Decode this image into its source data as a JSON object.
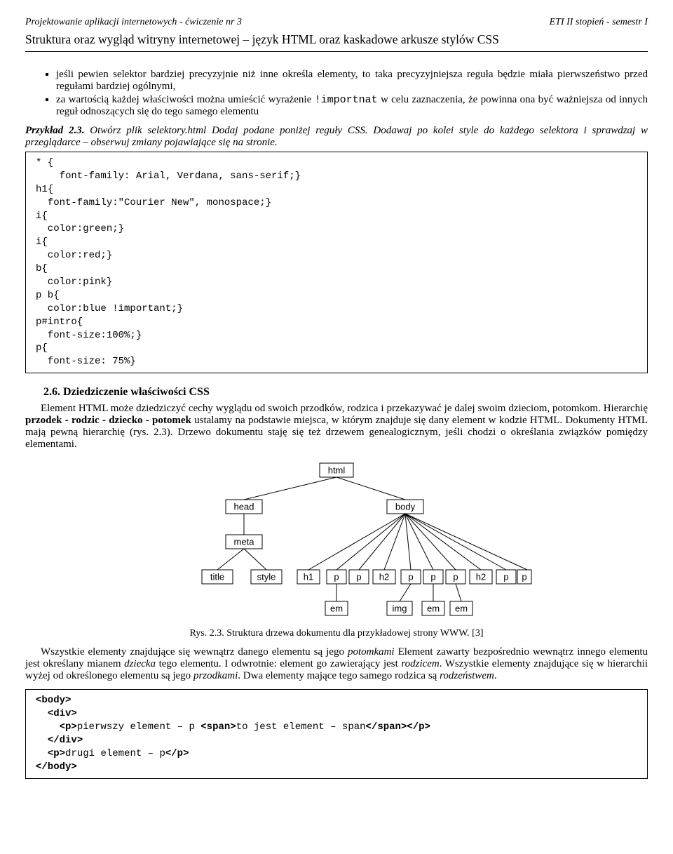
{
  "header": {
    "left": "Projektowanie aplikacji internetowych  - ćwiczenie nr 3",
    "right": "ETI II stopień - semestr I",
    "title": "Struktura oraz wygląd witryny internetowej – język HTML oraz kaskadowe arkusze stylów CSS"
  },
  "bullets": {
    "b1": "jeśli pewien selektor bardziej precyzyjnie niż inne określa elementy, to taka precyzyjniejsza reguła będzie miała pierwszeństwo przed regułami bardziej ogólnymi,",
    "b2a": "za wartością każdej właściwości można umieścić wyrażenie ",
    "b2code": "!importnat",
    "b2b": " w celu zaznaczenia, że powinna ona być ważniejsza od innych reguł odnoszących się do tego samego elementu"
  },
  "example": {
    "label_bold": "Przykład 2.3.",
    "label_italic": " Otwórz plik selektory.html Dodaj podane poniżej reguły CSS. Dodawaj po kolei style do każdego selektora i sprawdzaj  w przeglądarce – obserwuj zmiany pojawiające się na stronie."
  },
  "code1": "* {\n    font-family: Arial, Verdana, sans-serif;}\nh1{\n  font-family:\"Courier New\", monospace;}\ni{\n  color:green;}\ni{\n  color:red;}\nb{\n  color:pink}\np b{\n  color:blue !important;}\np#intro{\n  font-size:100%;}\np{\n  font-size: 75%}",
  "section": {
    "heading": "2.6. Dziedziczenie właściwości CSS",
    "p1a": "Element HTML może dziedziczyć cechy wyglądu od swoich przodków, rodzica i przekazywać je dalej swoim dzieciom, potomkom. Hierarchię ",
    "p1b": "przodek - rodzic - dziecko - potomek",
    "p1c": " ustalamy na podstawie miejsca, w którym znajduje się dany element w kodzie HTML. Dokumenty HTML mają pewną hierarchię (rys. 2.3). Drzewo dokumentu staję się też drzewem genealogicznym, jeśli chodzi o określania związków pomiędzy elementami.",
    "caption": "Rys. 2.3. Struktura drzewa dokumentu dla przykładowej strony WWW. [3]",
    "p2a": "Wszystkie elementy znajdujące się wewnątrz danego elementu są jego ",
    "p2i1": "potomkami",
    "p2b": " Element zawarty bezpośrednio wewnątrz innego elementu jest określany mianem ",
    "p2i2": "dziecka",
    "p2c": " tego elementu. I odwrotnie: element go zawierający jest ",
    "p2i3": "rodzicem",
    "p2d": ". Wszystkie elementy znajdujące się w hierarchii wyżej od określonego elementu są jego ",
    "p2i4": "przodkami",
    "p2e": ". Dwa elementy mające tego samego rodzica są ",
    "p2i5": "rodzeństwem",
    "p2f": "."
  },
  "code2": "<body>\n  <div>\n    <p>pierwszy element – p <span>to jest element – span</span></p>\n  </div>\n  <p>drugi element – p</p>\n</body>",
  "tree": {
    "html": "html",
    "head": "head",
    "body": "body",
    "meta": "meta",
    "title": "title",
    "style": "style",
    "h1": "h1",
    "p": "p",
    "h2": "h2",
    "em": "em",
    "img": "img"
  }
}
